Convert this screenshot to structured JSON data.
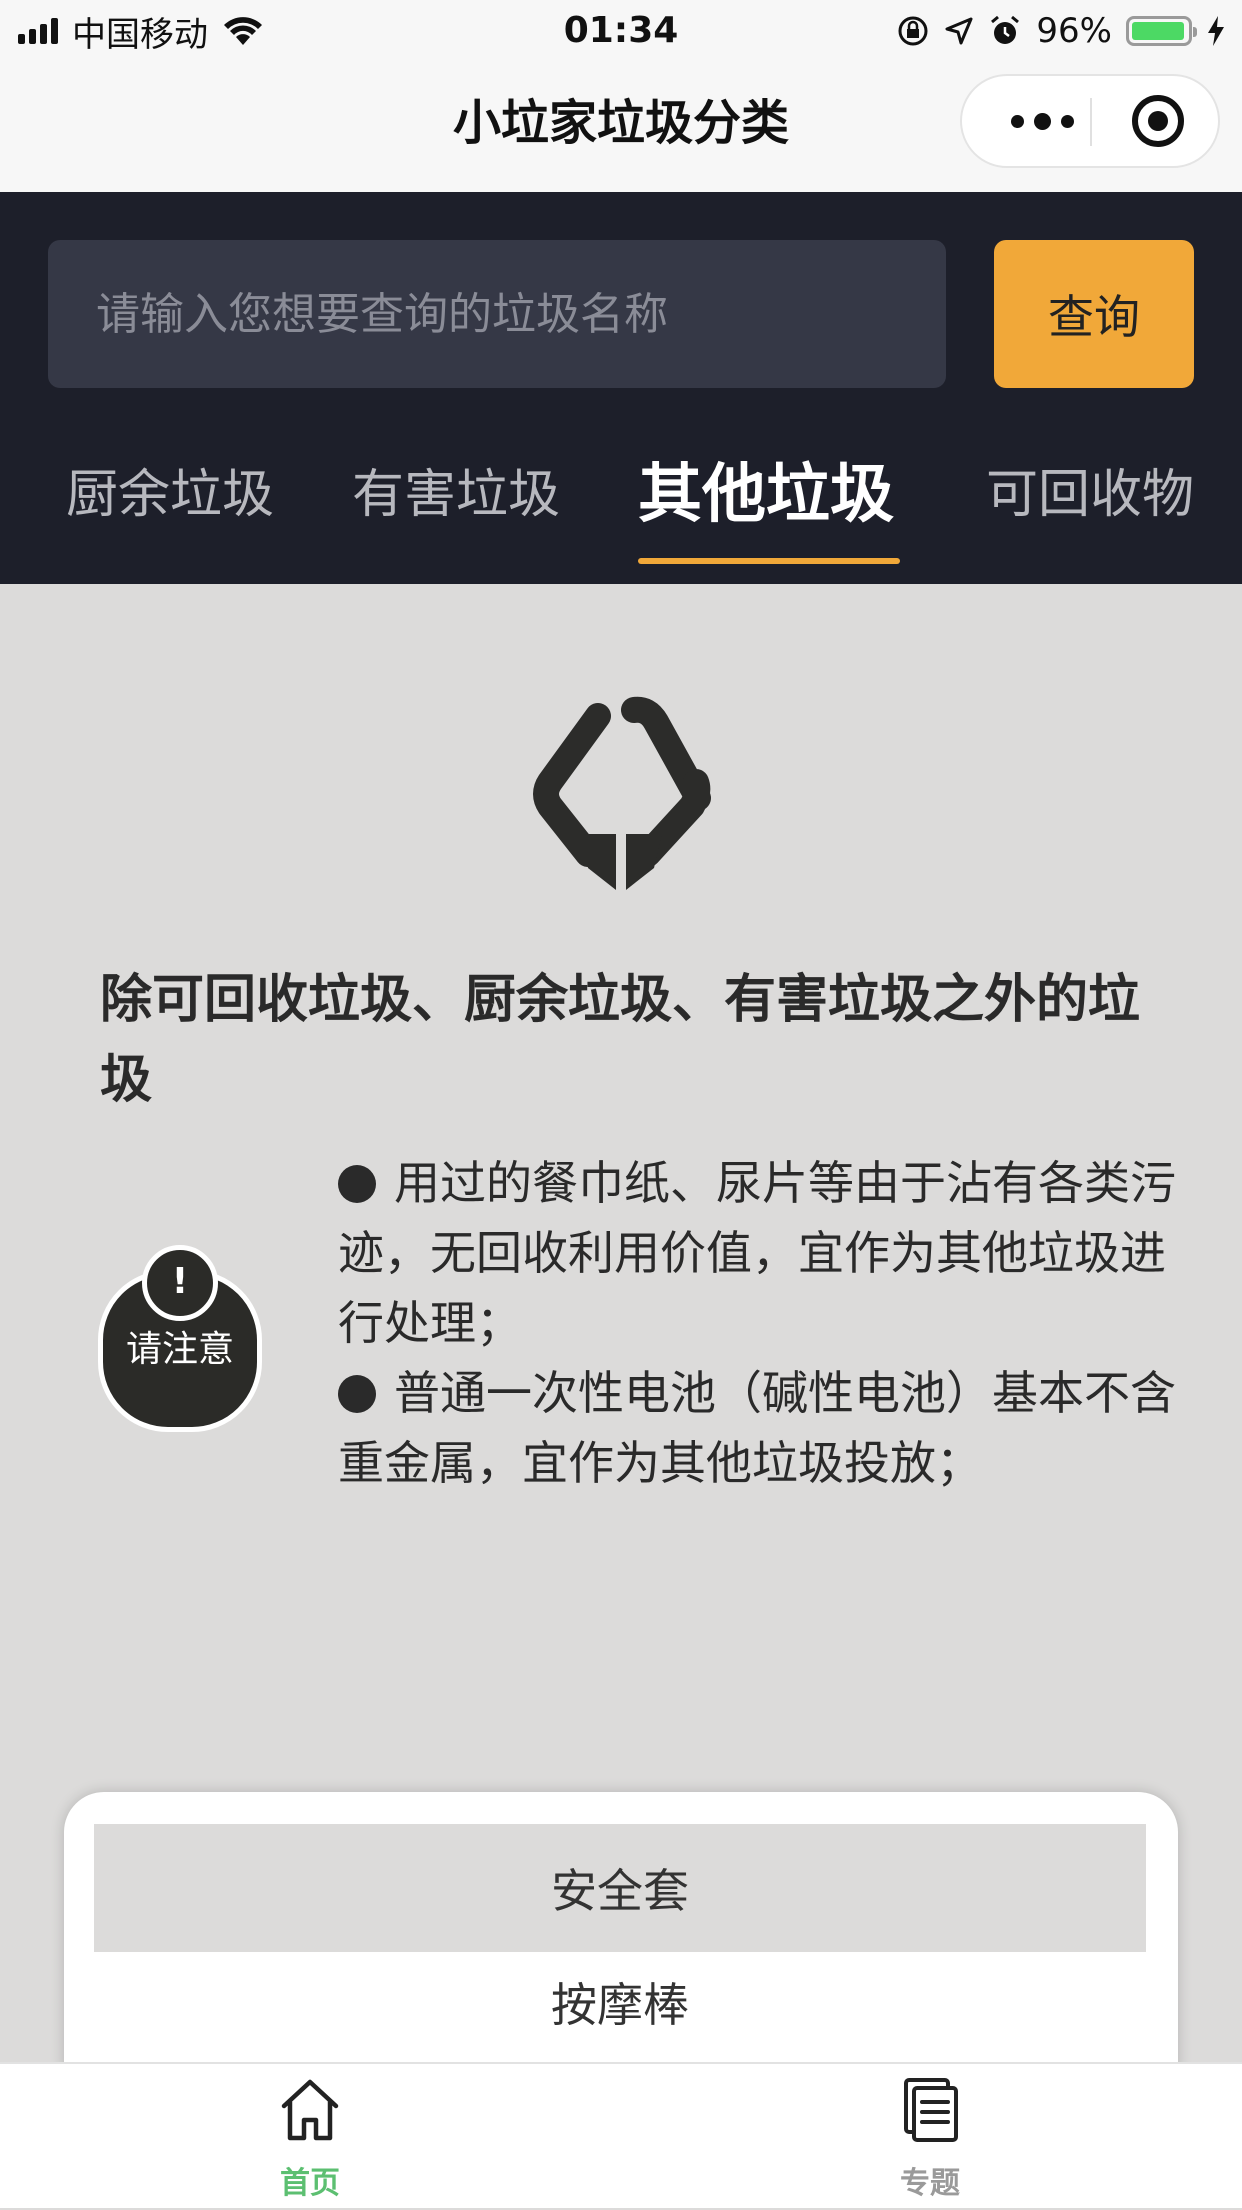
{
  "status_bar": {
    "carrier": "中国移动",
    "time": "01:34",
    "battery_percent": "96%",
    "battery_level": 0.96
  },
  "nav": {
    "title": "小垃家垃圾分类"
  },
  "search": {
    "placeholder": "请输入您想要查询的垃圾名称",
    "button_label": "查询"
  },
  "category_tabs": [
    {
      "label": "厨余垃圾",
      "active": false
    },
    {
      "label": "有害垃圾",
      "active": false
    },
    {
      "label": "其他垃圾",
      "active": true
    },
    {
      "label": "可回收物",
      "active": false
    }
  ],
  "content": {
    "heading": "除可回收垃圾、厨余垃圾、有害垃圾之外的垃圾",
    "notice_mark": "!",
    "notice_label": "请注意",
    "tips": [
      "用过的餐巾纸、尿片等由于沾有各类污迹，无回收利用价值，宜作为其他垃圾进行处理；",
      "普通一次性电池（碱性电池）基本不含重金属，宜作为其他垃圾投放；"
    ]
  },
  "suggestions": [
    "安全套",
    "按摩棒"
  ],
  "tab_bar": {
    "items": [
      {
        "label": "首页",
        "icon": "home-icon",
        "active": true
      },
      {
        "label": "专题",
        "icon": "document-list-icon",
        "active": false
      }
    ]
  },
  "colors": {
    "accent": "#f1a839",
    "header_bg": "#1d1f2a",
    "content_bg": "#dcdbda",
    "tab_active": "#5cbf71",
    "tab_inactive": "#9a9a9a"
  }
}
